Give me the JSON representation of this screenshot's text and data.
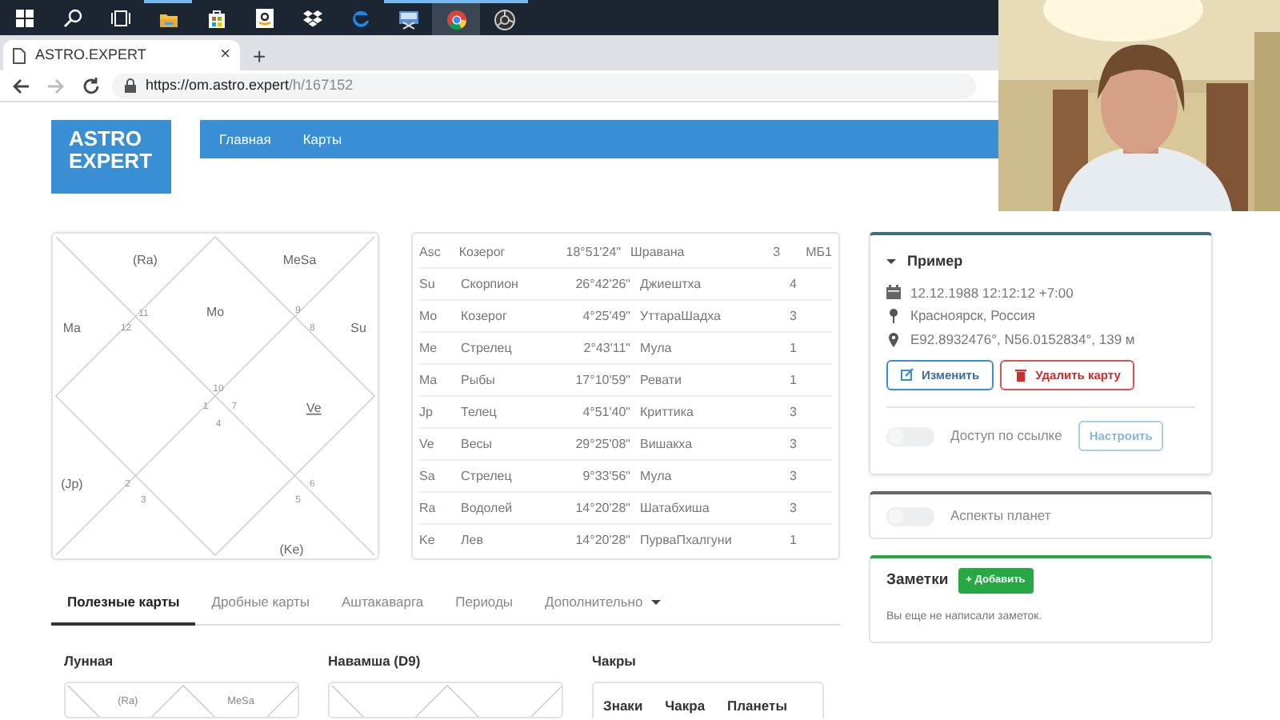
{
  "taskbar": {
    "apps": [
      {
        "kind": "start",
        "running": false,
        "active": false
      },
      {
        "kind": "search",
        "running": false,
        "active": false
      },
      {
        "kind": "task-view",
        "running": false,
        "active": false
      },
      {
        "kind": "folder",
        "running": true,
        "active": false
      },
      {
        "kind": "store",
        "running": false,
        "active": false
      },
      {
        "kind": "amazon",
        "running": false,
        "active": false
      },
      {
        "kind": "dropbox",
        "running": false,
        "active": false
      },
      {
        "kind": "edge",
        "running": false,
        "active": false
      },
      {
        "kind": "screen-app",
        "running": true,
        "active": false
      },
      {
        "kind": "chrome",
        "running": true,
        "active": true
      },
      {
        "kind": "recorder",
        "running": true,
        "active": false
      }
    ]
  },
  "browser": {
    "tab_title": "ASTRO.EXPERT",
    "tab_close": "×",
    "new_tab": "+",
    "url_host": "https://om.astro.expert",
    "url_path": "/h/167152",
    "nav_buttons": [
      {
        "kind": "back",
        "disabled": false
      },
      {
        "kind": "forward",
        "disabled": true
      },
      {
        "kind": "reload",
        "disabled": false
      }
    ]
  },
  "site": {
    "logo": "ASTRO EXPERT",
    "nav": [
      {
        "label": "Главная"
      },
      {
        "label": "Карты"
      }
    ]
  },
  "chart": {
    "houses": [
      {
        "kind": "top-left",
        "number": "11",
        "planets": [
          {
            "label": "(Ra)",
            "underlined": false
          }
        ]
      },
      {
        "kind": "top-right",
        "number": "9",
        "planets": [
          {
            "label": "MeSa",
            "underlined": false
          }
        ]
      },
      {
        "kind": "top",
        "number": "10",
        "planets": [
          {
            "label": "Mo",
            "underlined": false
          }
        ]
      },
      {
        "kind": "left-upper",
        "number": "12",
        "planets": [
          {
            "label": "Ma",
            "underlined": false
          }
        ]
      },
      {
        "kind": "right-upper",
        "number": "8",
        "planets": [
          {
            "label": "Su",
            "underlined": false
          }
        ]
      },
      {
        "kind": "left",
        "number": "1"
      },
      {
        "kind": "right",
        "number": "7",
        "planets": [
          {
            "label": "Ve",
            "underlined": true
          }
        ]
      },
      {
        "kind": "bottom",
        "number": "4"
      },
      {
        "kind": "left-lower",
        "number": "2",
        "planets": [
          {
            "label": "(Jp)",
            "underlined": false
          }
        ]
      },
      {
        "kind": "right-lower",
        "number": "6"
      },
      {
        "kind": "bottom-left",
        "number": "3"
      },
      {
        "kind": "bottom-right",
        "number": "5",
        "planets": [
          {
            "label": "(Ke)",
            "underlined": false
          }
        ]
      }
    ]
  },
  "planets_table": {
    "rows": [
      {
        "planet": "Asc",
        "sign": "Козерог",
        "degree": "18°51'24\"",
        "nakshatra": "Шравана",
        "pada": "3",
        "note": "МБ1"
      },
      {
        "planet": "Su",
        "sign": "Скорпион",
        "degree": "26°42'26\"",
        "nakshatra": "Джиештха",
        "pada": "4"
      },
      {
        "planet": "Mo",
        "sign": "Козерог",
        "degree": "4°25'49\"",
        "nakshatra": "УттараШадха",
        "pada": "3"
      },
      {
        "planet": "Me",
        "sign": "Стрелец",
        "degree": "2°43'11\"",
        "nakshatra": "Мула",
        "pada": "1"
      },
      {
        "planet": "Ma",
        "sign": "Рыбы",
        "degree": "17°10'59\"",
        "nakshatra": "Ревати",
        "pada": "1"
      },
      {
        "planet": "Jp",
        "sign": "Телец",
        "degree": "4°51'40\"",
        "nakshatra": "Криттика",
        "pada": "3"
      },
      {
        "planet": "Ve",
        "sign": "Весы",
        "degree": "29°25'08\"",
        "nakshatra": "Вишакха",
        "pada": "3"
      },
      {
        "planet": "Sa",
        "sign": "Стрелец",
        "degree": "9°33'56\"",
        "nakshatra": "Мула",
        "pada": "3"
      },
      {
        "planet": "Ra",
        "sign": "Водолей",
        "degree": "14°20'28\"",
        "nakshatra": "Шатабхиша",
        "pada": "3"
      },
      {
        "planet": "Ke",
        "sign": "Лев",
        "degree": "14°20'28\"",
        "nakshatra": "ПурваПхалгуни",
        "pada": "1"
      }
    ]
  },
  "profile": {
    "title": "Пример",
    "expanded": true,
    "datetime": "12.12.1988 12:12:12 +7:00",
    "place": "Красноярск, Россия",
    "coords": "E92.8932476°, N56.0152834°, 139 м",
    "buttons": [
      {
        "kind": "edit",
        "label": "Изменить"
      },
      {
        "kind": "delete",
        "label": "Удалить карту"
      }
    ],
    "share": {
      "label": "Доступ по ссылке",
      "on": false,
      "button": "Настроить"
    }
  },
  "aspects": {
    "label": "Аспекты планет",
    "on": false
  },
  "notes": {
    "title": "Заметки",
    "add_button": "+ Добавить",
    "empty_text": "Вы еще не написали заметок."
  },
  "tabs": [
    {
      "label": "Полезные карты",
      "selected": true,
      "dropdown": false
    },
    {
      "label": "Дробные карты",
      "selected": false,
      "dropdown": false
    },
    {
      "label": "Аштакаварга",
      "selected": false,
      "dropdown": false
    },
    {
      "label": "Периоды",
      "selected": false,
      "dropdown": false
    },
    {
      "label": "Дополнительно",
      "selected": false,
      "dropdown": true
    }
  ],
  "panels": [
    {
      "kind": "chart",
      "title": "Лунная",
      "labels": [
        "(Ra)",
        "MeSa"
      ]
    },
    {
      "kind": "chart",
      "title": "Навамша (D9)"
    },
    {
      "kind": "table",
      "title": "Чакры",
      "columns": [
        "Знаки",
        "Чакра",
        "Планеты"
      ]
    }
  ]
}
